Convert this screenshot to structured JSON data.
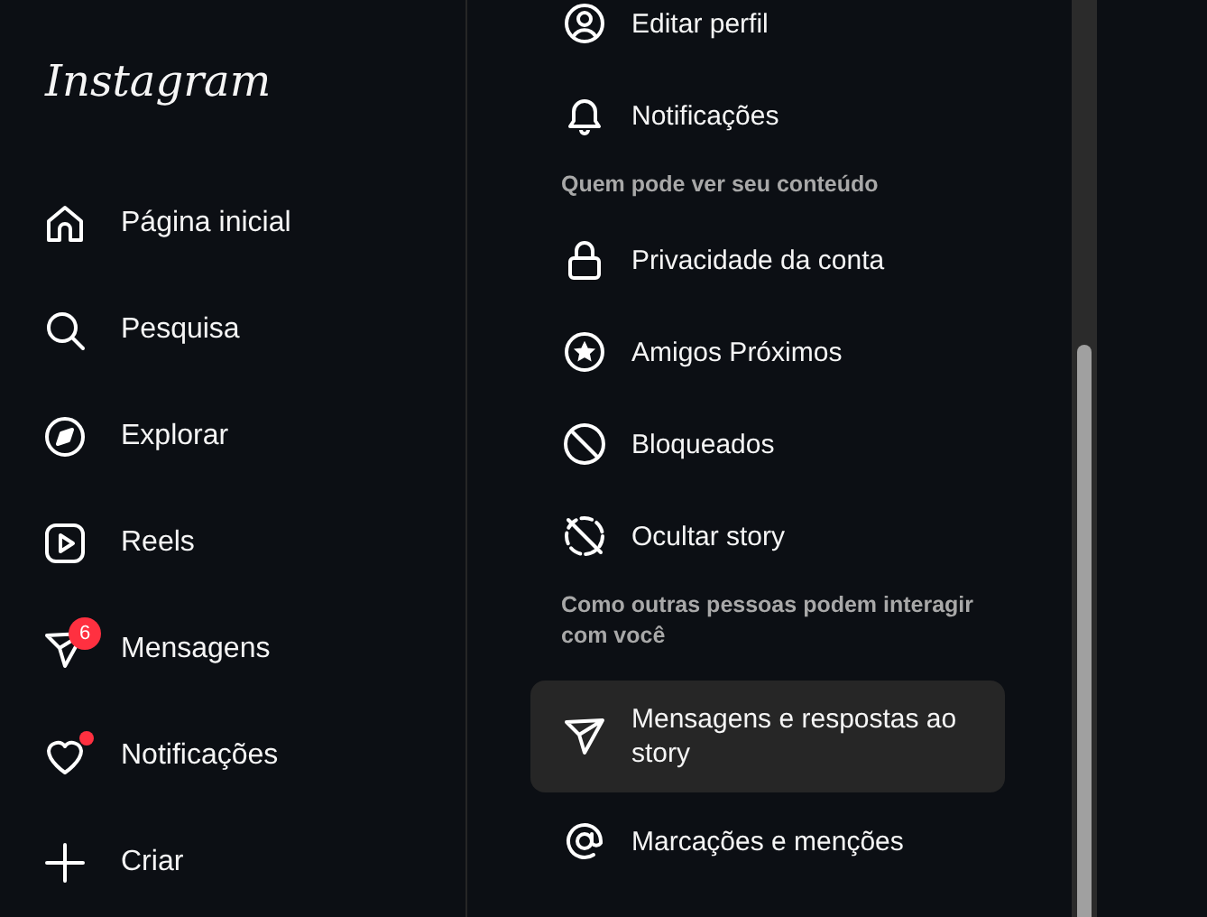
{
  "logo": "Instagram",
  "nav": [
    {
      "kind": "home",
      "label": "Página inicial"
    },
    {
      "kind": "search",
      "label": "Pesquisa"
    },
    {
      "kind": "compass",
      "label": "Explorar"
    },
    {
      "kind": "reels",
      "label": "Reels"
    },
    {
      "kind": "messages",
      "label": "Mensagens",
      "badge": "6"
    },
    {
      "kind": "heart",
      "label": "Notificações",
      "dot": true
    },
    {
      "kind": "plus",
      "label": "Criar"
    }
  ],
  "settings": [
    {
      "kind": "item",
      "label": "Editar perfil",
      "selected": false
    },
    {
      "kind": "item",
      "label": "Notificações",
      "selected": false
    },
    {
      "kind": "header",
      "label": "Quem pode ver seu conteúdo"
    },
    {
      "kind": "item",
      "label": "Privacidade da conta",
      "selected": false
    },
    {
      "kind": "item",
      "label": "Amigos Próximos",
      "selected": false
    },
    {
      "kind": "item",
      "label": "Bloqueados",
      "selected": false
    },
    {
      "kind": "item",
      "label": "Ocultar story",
      "selected": false
    },
    {
      "kind": "header",
      "label": "Como outras pessoas podem interagir com você"
    },
    {
      "kind": "item",
      "label": "Mensagens e respostas ao story",
      "selected": true
    },
    {
      "kind": "item",
      "label": "Marcações e menções",
      "selected": false
    }
  ]
}
